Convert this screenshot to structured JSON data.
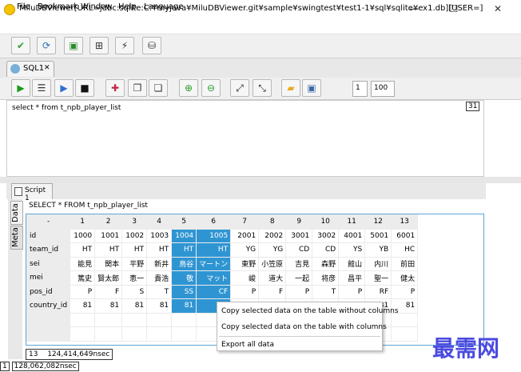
{
  "window": {
    "title": "MiluDBViewer[URL=jdbc:sqlite:C:¥myjava¥MiluDBViewer.git¥sample¥swingtest¥test1-1¥sql¥sqlite¥ex1.db][USER=]",
    "minimize": "—",
    "maximize": "☐",
    "close": "✕"
  },
  "menu": [
    "File",
    "Bookmark",
    "Window",
    "Help",
    "Language"
  ],
  "toolbar1": [
    {
      "icon": "check-icon",
      "glyph": "✔",
      "color": "#2fa02f"
    },
    {
      "icon": "refresh-icon",
      "glyph": "⟳",
      "color": "#2f6fb8"
    },
    {
      "icon": "new-window-icon",
      "glyph": "▣",
      "color": "#2a8a2a"
    },
    {
      "icon": "window-icon",
      "glyph": "⊞",
      "color": "#333333"
    },
    {
      "icon": "connect-icon",
      "glyph": "⚡",
      "color": "#333333"
    },
    {
      "icon": "database-icon",
      "glyph": "⛁",
      "color": "#333333"
    }
  ],
  "tabs": {
    "sql": "SQL1",
    "close": "✕",
    "script": "Script 1"
  },
  "toolbar2": [
    {
      "icon": "run-icon",
      "glyph": "▶",
      "color": "#1a9a1a"
    },
    {
      "icon": "explain-icon",
      "glyph": "☰",
      "color": "#333333"
    },
    {
      "icon": "play-circle-icon",
      "glyph": "▶",
      "color": "#2f6fcf"
    },
    {
      "icon": "stop-icon",
      "glyph": "■",
      "color": "#111111"
    },
    {
      "icon": "rotate-table-icon",
      "glyph": "✚",
      "color": "#c0244a"
    },
    {
      "icon": "copy-icon",
      "glyph": "❐",
      "color": "#333333"
    },
    {
      "icon": "copy-all-icon",
      "glyph": "❏",
      "color": "#333333"
    },
    {
      "icon": "zoom-in-icon",
      "glyph": "⊕",
      "color": "#2a9a2a"
    },
    {
      "icon": "zoom-out-icon",
      "glyph": "⊖",
      "color": "#2a9a2a"
    },
    {
      "icon": "expand-icon",
      "glyph": "⤢",
      "color": "#222222"
    },
    {
      "icon": "collapse-icon",
      "glyph": "⤡",
      "color": "#222222"
    },
    {
      "icon": "open-folder-icon",
      "glyph": "▰",
      "color": "#e8a81c"
    },
    {
      "icon": "save-icon",
      "glyph": "▣",
      "color": "#3a6aa6"
    }
  ],
  "paging": {
    "page": "1",
    "rows": "100"
  },
  "editor": {
    "sql": "select * from t_npb_player_list",
    "line_count": "31"
  },
  "sidetabs": {
    "data": "Data",
    "meta": "Meta"
  },
  "query_label": "SELECT * FROM t_npb_player_list",
  "table": {
    "header": [
      "-",
      "1",
      "2",
      "3",
      "4",
      "5",
      "6",
      "7",
      "8",
      "9",
      "10",
      "11",
      "12",
      "13"
    ],
    "rows": [
      [
        "id",
        "1000",
        "1001",
        "1002",
        "1003",
        "1004",
        "1005",
        "2001",
        "2002",
        "3001",
        "3002",
        "4001",
        "5001",
        "6001"
      ],
      [
        "team_id",
        "HT",
        "HT",
        "HT",
        "HT",
        "HT",
        "HT",
        "YG",
        "YG",
        "CD",
        "CD",
        "YS",
        "YB",
        "HC"
      ],
      [
        "sei",
        "能見",
        "関本",
        "平野",
        "新井",
        "鳥谷",
        "マートン",
        "東野",
        "小笠原",
        "吉見",
        "森野",
        "館山",
        "内川",
        "前田"
      ],
      [
        "mei",
        "篤史",
        "賢太郎",
        "恵一",
        "貴浩",
        "敬",
        "マット",
        "峻",
        "道大",
        "一起",
        "将彦",
        "昌平",
        "聖一",
        "健太"
      ],
      [
        "pos_id",
        "P",
        "F",
        "S",
        "T",
        "SS",
        "CF",
        "P",
        "F",
        "P",
        "T",
        "P",
        "RF",
        "P"
      ],
      [
        "country_id",
        "81",
        "81",
        "81",
        "81",
        "81",
        "",
        "",
        "",
        "",
        "",
        "",
        "81",
        "81"
      ],
      [
        "",
        "",
        "",
        "",
        "",
        "",
        "",
        "",
        "",
        "",
        "",
        "",
        "",
        ""
      ],
      [
        "",
        "",
        "",
        "",
        "",
        "",
        "",
        "",
        "",
        "",
        "",
        "",
        "",
        ""
      ]
    ]
  },
  "context_menu": {
    "copy_without_columns": "Copy selected data on the table without columns",
    "copy_with_columns": "Copy selected data on the table with columns",
    "export_all": "Export all data"
  },
  "status": {
    "count": "13",
    "time1": "124,414,649nsec",
    "page": "1",
    "time2": "128,062,082nsec"
  },
  "watermark": "最需网"
}
